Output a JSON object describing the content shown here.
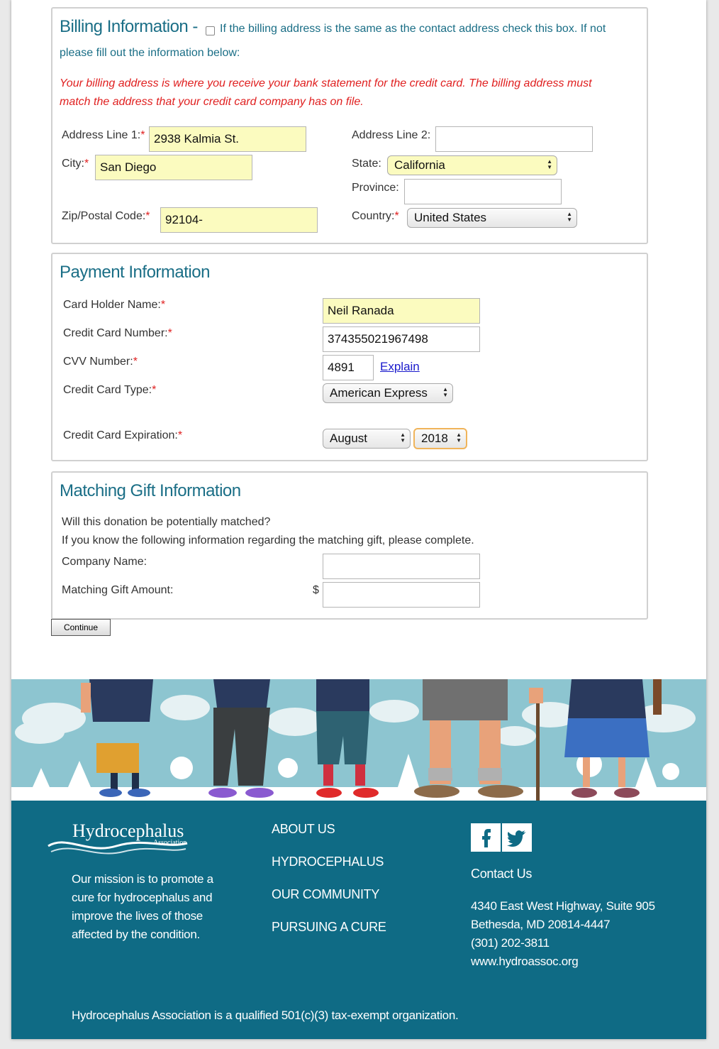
{
  "billing": {
    "title": "Billing Information -",
    "same_note": "If the billing address is the same as the contact address check this box. If not",
    "same_note2": "please fill out the information below:",
    "warning1": "Your billing address is where you receive your bank statement for the credit card. The billing address must",
    "warning2": "match the address that your credit card company has on file.",
    "address1_label": "Address Line 1:",
    "address1_value": "2938 Kalmia St.",
    "address2_label": "Address Line 2:",
    "address2_value": "",
    "city_label": "City:",
    "city_value": "San Diego",
    "state_label": "State:",
    "state_value": "California",
    "province_label": "Province:",
    "province_value": "",
    "zip_label": "Zip/Postal Code:",
    "zip_value": "92104-",
    "country_label": "Country:",
    "country_value": "United States",
    "required_mark": "*"
  },
  "payment": {
    "title": "Payment Information",
    "holder_label": "Card Holder Name:",
    "holder_value": "Neil Ranada",
    "number_label": "Credit Card Number:",
    "number_value": "374355021967498",
    "cvv_label": "CVV Number:",
    "cvv_value": "4891",
    "explain_link": "Explain",
    "type_label": "Credit Card Type:",
    "type_value": "American Express",
    "exp_label": "Credit Card Expiration:",
    "exp_month": "August",
    "exp_year": "2018"
  },
  "matching": {
    "title": "Matching Gift Information",
    "question": "Will this donation be potentially matched?",
    "instruction": "If you know the following information regarding the matching gift, please complete.",
    "company_label": "Company Name:",
    "company_value": "",
    "amount_label": "Matching Gift Amount:",
    "currency": "$",
    "amount_value": ""
  },
  "continue_label": "Continue",
  "footer": {
    "logo_text": "Hydrocephalus",
    "logo_sub": "Association",
    "mission": [
      "Our mission is to promote a",
      "cure for hydrocephalus and",
      "improve the lives of those",
      "affected by the condition."
    ],
    "nav": [
      "ABOUT US",
      "HYDROCEPHALUS",
      "OUR COMMUNITY",
      "PURSUING A CURE"
    ],
    "contact_title": "Contact Us",
    "address1": "4340 East West Highway, Suite 905",
    "address2": "Bethesda, MD 20814-4447",
    "phone": "(301) 202-3811",
    "website": "www.hydroassoc.org",
    "tax_note": "Hydrocephalus Association is a qualified 501(c)(3) tax-exempt organization.",
    "accent_color": "#0f6b85"
  }
}
